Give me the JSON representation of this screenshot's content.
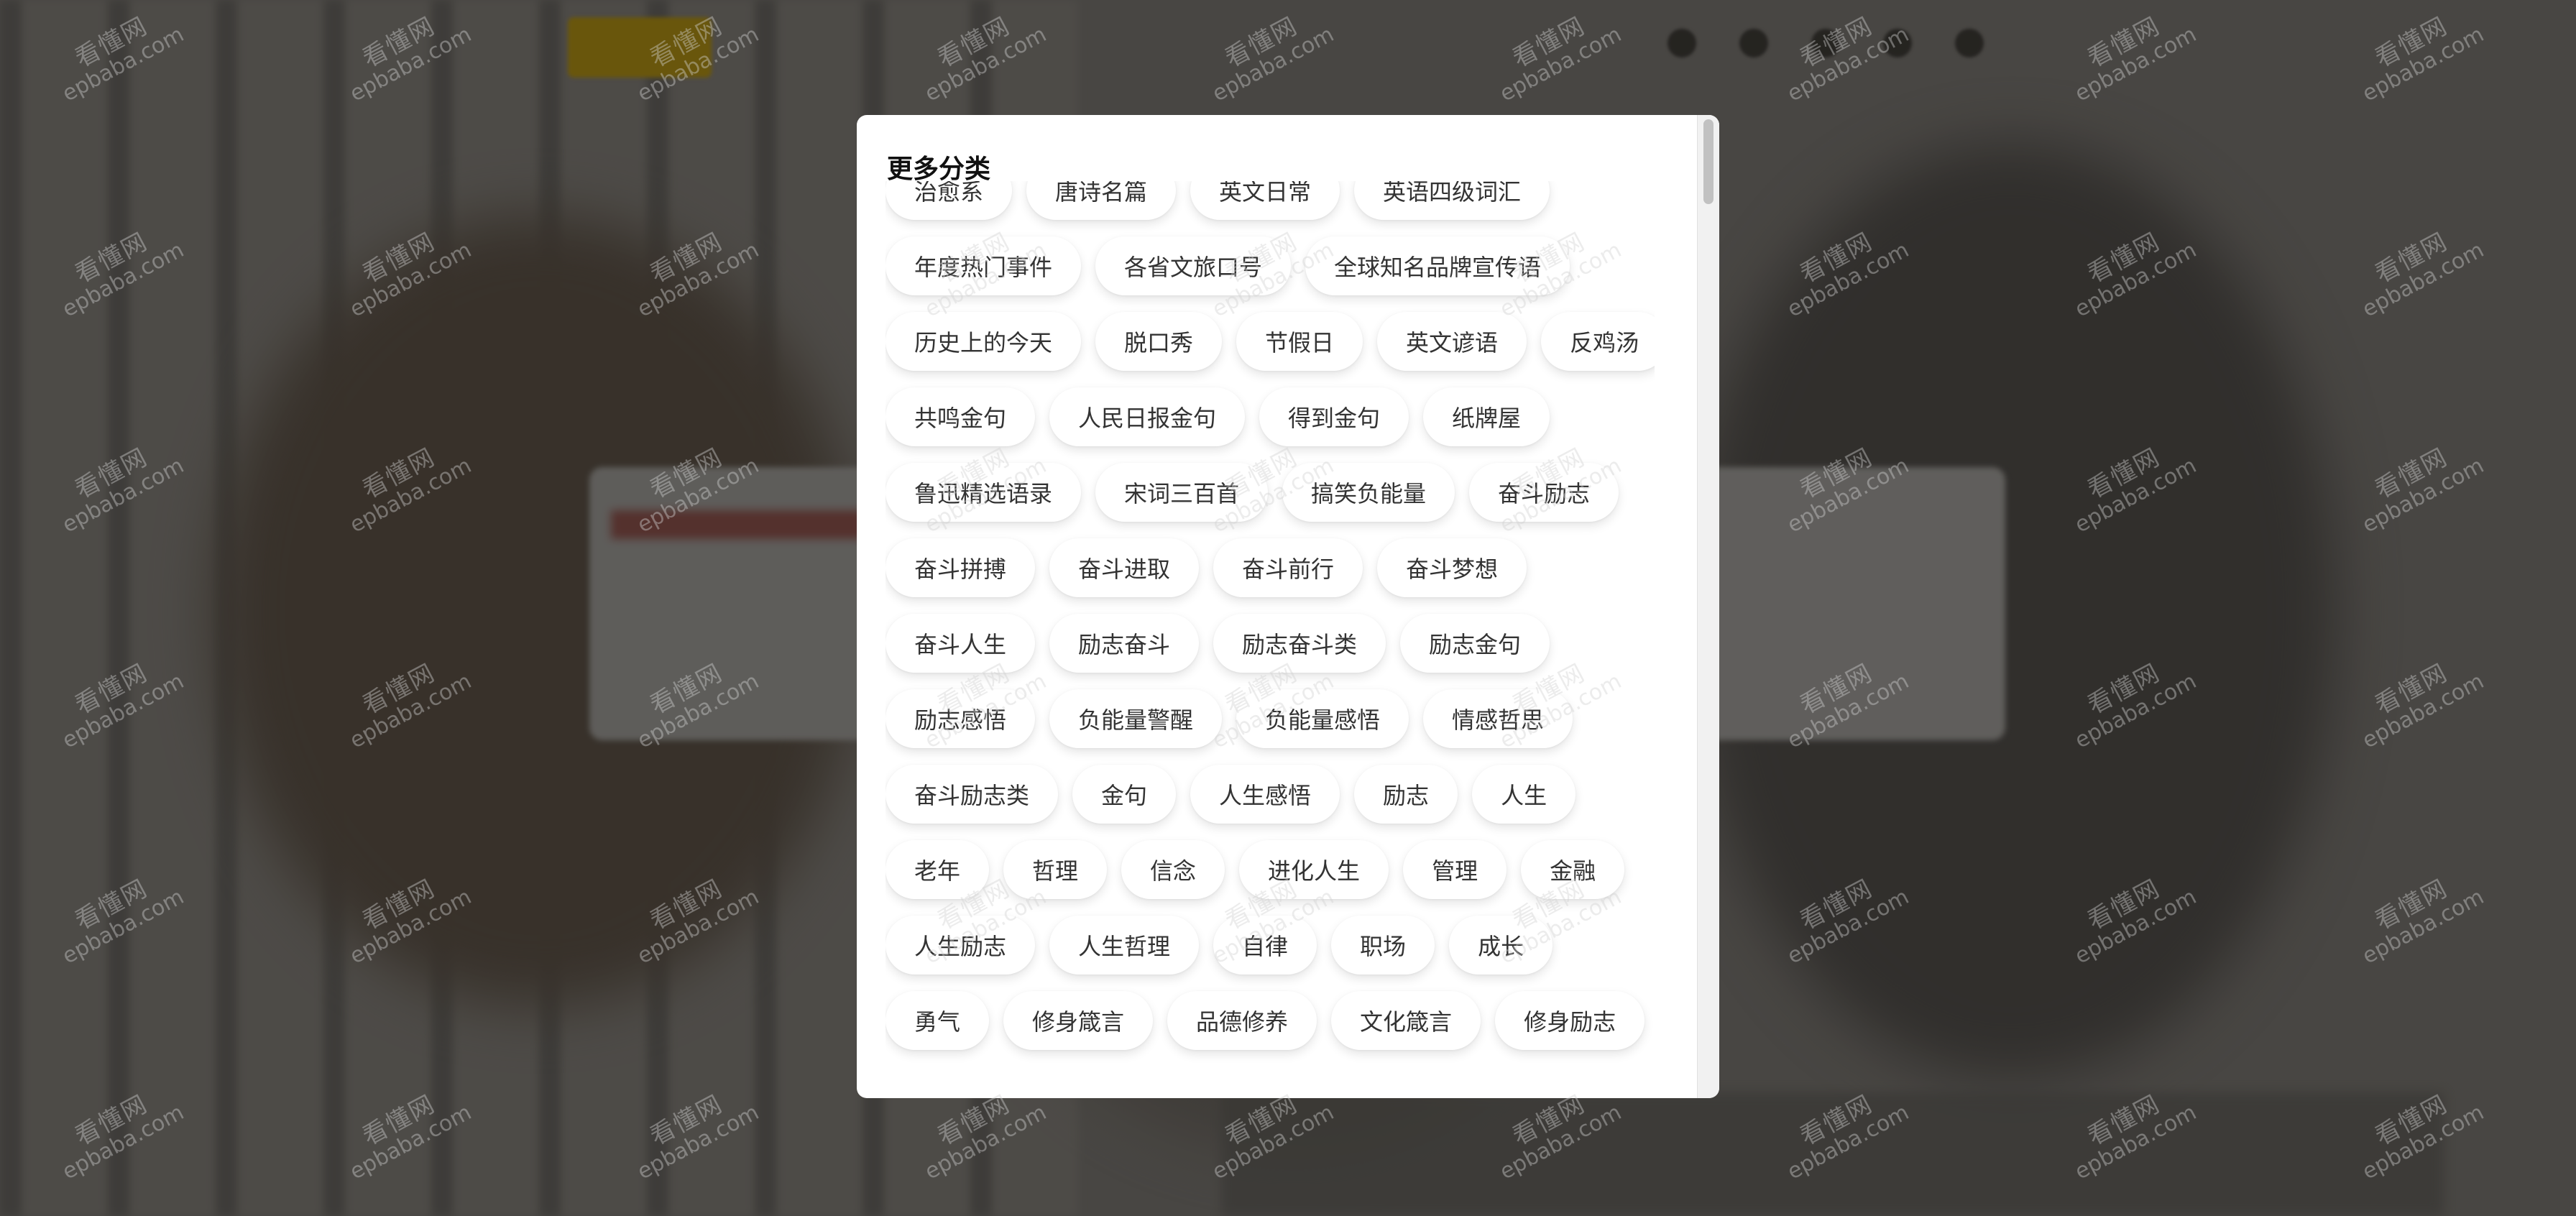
{
  "modal": {
    "title": "更多分类",
    "tag_rows": [
      [
        "治愈系",
        "唐诗名篇",
        "英文日常",
        "英语四级词汇"
      ],
      [
        "年度热门事件",
        "各省文旅口号",
        "全球知名品牌宣传语"
      ],
      [
        "历史上的今天",
        "脱口秀",
        "节假日",
        "英文谚语",
        "反鸡汤"
      ],
      [
        "共鸣金句",
        "人民日报金句",
        "得到金句",
        "纸牌屋"
      ],
      [
        "鲁迅精选语录",
        "宋词三百首",
        "搞笑负能量",
        "奋斗励志"
      ],
      [
        "奋斗拼搏",
        "奋斗进取",
        "奋斗前行",
        "奋斗梦想"
      ],
      [
        "奋斗人生",
        "励志奋斗",
        "励志奋斗类",
        "励志金句"
      ],
      [
        "励志感悟",
        "负能量警醒",
        "负能量感悟",
        "情感哲思"
      ],
      [
        "奋斗励志类",
        "金句",
        "人生感悟",
        "励志",
        "人生"
      ],
      [
        "老年",
        "哲理",
        "信念",
        "进化人生",
        "管理",
        "金融"
      ],
      [
        "人生励志",
        "人生哲理",
        "自律",
        "职场",
        "成长"
      ],
      [
        "勇气",
        "修身箴言",
        "品德修养",
        "文化箴言",
        "修身励志"
      ]
    ]
  },
  "watermark": {
    "name": "看懂网",
    "url": "epbaba.com"
  },
  "colors": {
    "overlay": "rgba(0,0,0,0.48)",
    "modal_bg": "#ffffff",
    "tag_text": "#333333",
    "brand_yellow": "#caa517"
  }
}
